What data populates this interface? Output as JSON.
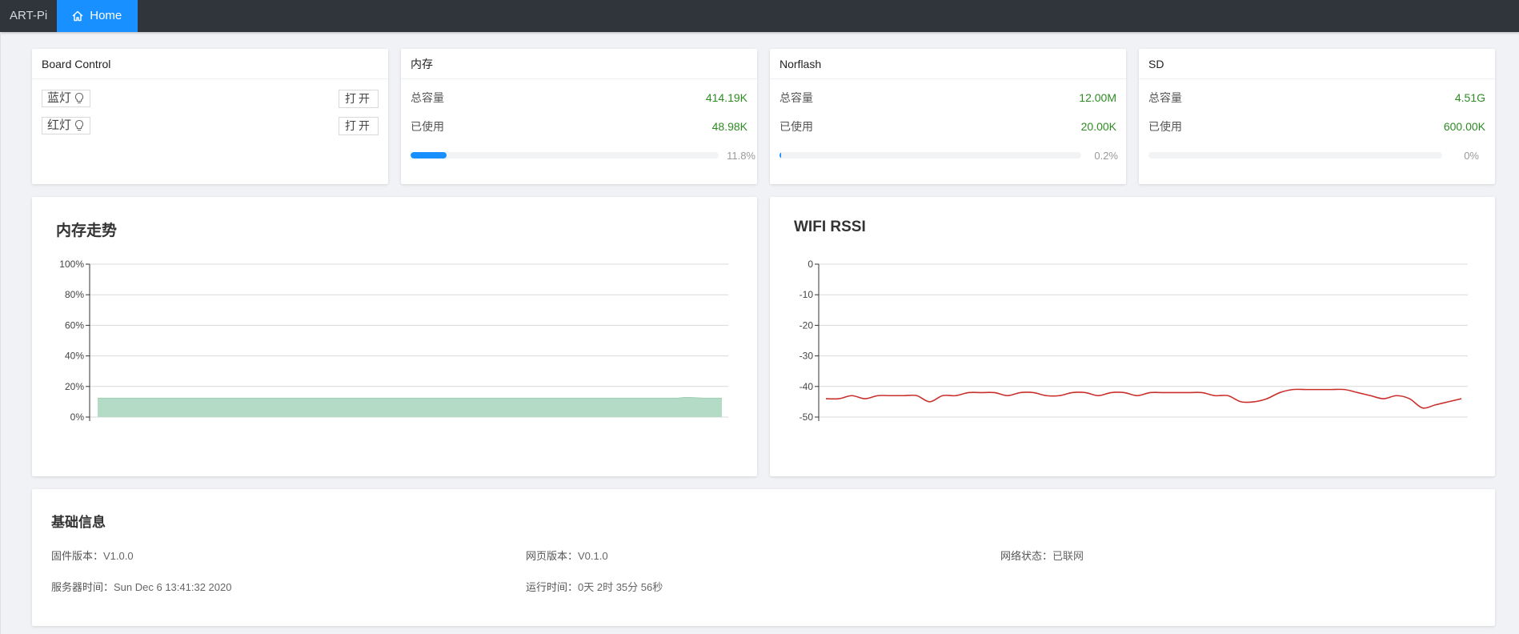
{
  "nav": {
    "brand": "ART-Pi",
    "home_label": "Home"
  },
  "board": {
    "title": "Board Control",
    "leds": [
      {
        "label": "蓝灯",
        "button": "打开"
      },
      {
        "label": "红灯",
        "button": "打开"
      }
    ]
  },
  "storage": [
    {
      "title": "内存",
      "total_label": "总容量",
      "total": "414.19K",
      "used_label": "已使用",
      "used": "48.98K",
      "percent": 11.8,
      "percent_label": "11.8%"
    },
    {
      "title": "Norflash",
      "total_label": "总容量",
      "total": "12.00M",
      "used_label": "已使用",
      "used": "20.00K",
      "percent": 0.2,
      "percent_label": "0.2%"
    },
    {
      "title": "SD",
      "total_label": "总容量",
      "total": "4.51G",
      "used_label": "已使用",
      "used": "600.00K",
      "percent": 0,
      "percent_label": "0%"
    }
  ],
  "chart_data": [
    {
      "type": "area",
      "title": "内存走势",
      "yticks": [
        "100%",
        "80%",
        "60%",
        "40%",
        "20%",
        "0%"
      ],
      "ylim": [
        0,
        100
      ],
      "grid": true,
      "color": "#b4dbc6",
      "values": [
        12.4,
        12.4,
        12.4,
        12.4,
        12.4,
        12.4,
        12.4,
        12.4,
        12.4,
        12.4,
        12.4,
        12.4,
        12.4,
        12.4,
        12.4,
        12.4,
        12.4,
        12.4,
        12.4,
        12.4,
        12.4,
        12.4,
        12.4,
        12.4,
        12.4,
        12.4,
        12.4,
        12.4,
        12.4,
        12.4,
        12.4,
        12.4,
        12.4,
        12.4,
        12.4,
        12.4,
        12.4,
        12.4,
        12.4,
        12.4,
        12.4,
        12.4,
        12.4,
        12.4,
        12.4,
        12.4,
        12.4,
        12.4,
        12.4,
        12.4,
        12.4,
        12.4,
        12.4,
        12.4,
        12.4,
        12.4,
        12.4,
        12.4,
        12.4,
        12.4,
        12.4,
        12.4,
        12.4,
        12.4,
        12.4,
        12.4,
        12.4,
        12.4,
        12.4,
        12.4,
        12.4,
        12.4,
        12.4,
        12.4,
        12.4,
        12.4,
        12.4,
        12.4,
        12.4,
        12.4,
        12.4,
        12.4,
        12.4,
        12.4,
        12.4,
        12.4,
        12.4,
        12.4,
        12.4,
        12.4,
        12.4,
        12.4,
        12.4,
        12.8,
        12.8,
        12.6,
        12.4,
        12.4,
        12.4,
        12.4
      ]
    },
    {
      "type": "line",
      "title": "WIFI RSSI",
      "yticks": [
        "0",
        "-10",
        "-20",
        "-30",
        "-40",
        "-50"
      ],
      "ylim": [
        -50,
        0
      ],
      "grid": true,
      "color": "#c9302c",
      "values": [
        -44,
        -44,
        -43,
        -44,
        -43,
        -43,
        -43,
        -43,
        -45,
        -43,
        -43,
        -42,
        -42,
        -42,
        -43,
        -42,
        -42,
        -43,
        -43,
        -42,
        -42,
        -43,
        -42,
        -42,
        -43,
        -42,
        -42,
        -42,
        -42,
        -42,
        -43,
        -43,
        -45,
        -45,
        -44,
        -42,
        -41,
        -41,
        -41,
        -41,
        -41,
        -42,
        -43,
        -44,
        -43,
        -44,
        -47,
        -46,
        -45,
        -44
      ]
    }
  ],
  "info": {
    "title": "基础信息",
    "firmware_label": "固件版本：",
    "firmware": "V1.0.0",
    "web_label": "网页版本：",
    "web": "V0.1.0",
    "network_label": "网络状态：",
    "network": "已联网",
    "server_time_label": "服务器时间：",
    "server_time": "Sun Dec 6 13:41:32 2020",
    "uptime_label": "运行时间：",
    "uptime": "0天 2时 35分 56秒"
  }
}
